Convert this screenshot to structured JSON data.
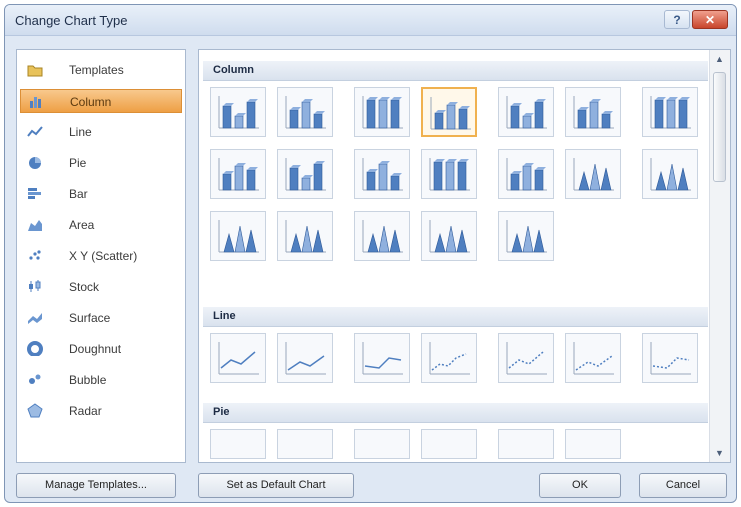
{
  "window": {
    "title": "Change Chart Type",
    "help_glyph": "?",
    "close_glyph": "✕"
  },
  "categories": [
    {
      "label": "Templates",
      "icon": "folder-icon",
      "selected": false
    },
    {
      "label": "Column",
      "icon": "column-chart-icon",
      "selected": true
    },
    {
      "label": "Line",
      "icon": "line-chart-icon",
      "selected": false
    },
    {
      "label": "Pie",
      "icon": "pie-chart-icon",
      "selected": false
    },
    {
      "label": "Bar",
      "icon": "bar-chart-icon",
      "selected": false
    },
    {
      "label": "Area",
      "icon": "area-chart-icon",
      "selected": false
    },
    {
      "label": "X Y (Scatter)",
      "icon": "scatter-chart-icon",
      "selected": false
    },
    {
      "label": "Stock",
      "icon": "stock-chart-icon",
      "selected": false
    },
    {
      "label": "Surface",
      "icon": "surface-chart-icon",
      "selected": false
    },
    {
      "label": "Doughnut",
      "icon": "doughnut-chart-icon",
      "selected": false
    },
    {
      "label": "Bubble",
      "icon": "bubble-chart-icon",
      "selected": false
    },
    {
      "label": "Radar",
      "icon": "radar-chart-icon",
      "selected": false
    }
  ],
  "sections": [
    {
      "title": "Column",
      "thumbnail_count": 19,
      "selected_index": 3
    },
    {
      "title": "Line",
      "thumbnail_count": 7,
      "selected_index": null
    },
    {
      "title": "Pie",
      "thumbnail_count": 6,
      "selected_index": null
    }
  ],
  "buttons": {
    "manage_templates": "Manage Templates...",
    "set_default": "Set as Default Chart",
    "ok": "OK",
    "cancel": "Cancel"
  },
  "scrollbar": {
    "up_glyph": "▲",
    "down_glyph": "▼"
  },
  "colors": {
    "accent_selected": "#f0b14f",
    "thumb_blue": "#4f7fc0",
    "panel_bg": "#dfe8f4"
  }
}
